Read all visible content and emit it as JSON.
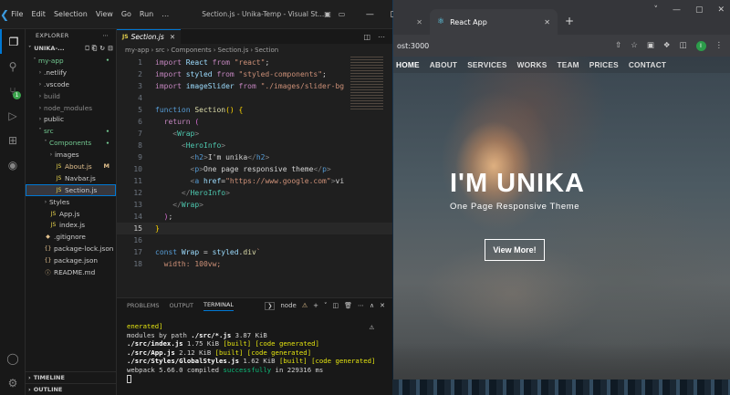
{
  "vscode": {
    "menu": [
      "File",
      "Edit",
      "Selection",
      "View",
      "Go",
      "Run",
      "…"
    ],
    "window_title": "Section.js - Unika-Temp - Visual St...",
    "explorer_title": "EXPLORER",
    "section_title": "UNIKA-...",
    "scm_badge": "1",
    "tree": [
      {
        "label": "my-app",
        "chev": "˅",
        "icon": "",
        "color": "c-green",
        "indent": 6,
        "status": "•",
        "status_color": "c-green"
      },
      {
        "label": ".netlify",
        "chev": "›",
        "icon": "",
        "color": "",
        "indent": 12,
        "status": "",
        "status_color": ""
      },
      {
        "label": ".vscode",
        "chev": "›",
        "icon": "",
        "color": "",
        "indent": 12,
        "status": "",
        "status_color": ""
      },
      {
        "label": "build",
        "chev": "›",
        "icon": "",
        "color": "c-gray",
        "indent": 12,
        "status": "",
        "status_color": ""
      },
      {
        "label": "node_modules",
        "chev": "›",
        "icon": "",
        "color": "c-gray",
        "indent": 12,
        "status": "",
        "status_color": ""
      },
      {
        "label": "public",
        "chev": "›",
        "icon": "",
        "color": "",
        "indent": 12,
        "status": "",
        "status_color": ""
      },
      {
        "label": "src",
        "chev": "˅",
        "icon": "",
        "color": "c-green",
        "indent": 12,
        "status": "•",
        "status_color": "c-green"
      },
      {
        "label": "Components",
        "chev": "˅",
        "icon": "",
        "color": "c-green",
        "indent": 18,
        "status": "•",
        "status_color": "c-green"
      },
      {
        "label": "images",
        "chev": "›",
        "icon": "",
        "color": "",
        "indent": 24,
        "status": "",
        "status_color": ""
      },
      {
        "label": "About.js",
        "chev": "",
        "icon": "JS",
        "color": "c-yellow",
        "indent": 24,
        "status": "M",
        "status_color": "c-yellow"
      },
      {
        "label": "Navbar.js",
        "chev": "",
        "icon": "JS",
        "color": "",
        "indent": 24,
        "status": "",
        "status_color": ""
      },
      {
        "label": "Section.js",
        "chev": "",
        "icon": "JS",
        "color": "",
        "indent": 24,
        "status": "",
        "status_color": "",
        "selected": true
      },
      {
        "label": "Styles",
        "chev": "›",
        "icon": "",
        "color": "",
        "indent": 18,
        "status": "",
        "status_color": ""
      },
      {
        "label": "App.js",
        "chev": "",
        "icon": "JS",
        "color": "",
        "indent": 18,
        "status": "",
        "status_color": ""
      },
      {
        "label": "index.js",
        "chev": "",
        "icon": "JS",
        "color": "",
        "indent": 18,
        "status": "",
        "status_color": ""
      },
      {
        "label": ".gitignore",
        "chev": "",
        "icon": "◆",
        "color": "",
        "indent": 12,
        "status": "",
        "status_color": ""
      },
      {
        "label": "package-lock.json",
        "chev": "",
        "icon": "{}",
        "color": "",
        "indent": 12,
        "status": "",
        "status_color": ""
      },
      {
        "label": "package.json",
        "chev": "",
        "icon": "{}",
        "color": "",
        "indent": 12,
        "status": "",
        "status_color": ""
      },
      {
        "label": "README.md",
        "chev": "",
        "icon": "ⓘ",
        "color": "",
        "indent": 12,
        "status": "",
        "status_color": ""
      }
    ],
    "footer": [
      "TIMELINE",
      "OUTLINE"
    ],
    "tab": "Section.js",
    "breadcrumb": [
      "my-app",
      "src",
      "Components",
      "Section.js",
      "Section"
    ],
    "current_line": 15,
    "code_lines": [
      [
        [
          "k",
          "import "
        ],
        [
          "v",
          "React "
        ],
        [
          "k",
          "from "
        ],
        [
          "s",
          "\"react\""
        ],
        [
          "tx",
          ";"
        ]
      ],
      [
        [
          "k",
          "import "
        ],
        [
          "v",
          "styled "
        ],
        [
          "k",
          "from "
        ],
        [
          "s",
          "\"styled-components\""
        ],
        [
          "tx",
          ";"
        ]
      ],
      [
        [
          "k",
          "import "
        ],
        [
          "v",
          "imageSlider "
        ],
        [
          "k",
          "from "
        ],
        [
          "s",
          "\"./images/slider-bg"
        ]
      ],
      [
        [
          "tx",
          ""
        ]
      ],
      [
        [
          "kb",
          "function "
        ],
        [
          "f",
          "Section"
        ],
        [
          "br",
          "() {"
        ]
      ],
      [
        [
          "tx",
          "  "
        ],
        [
          "k",
          "return "
        ],
        [
          "pu",
          "("
        ]
      ],
      [
        [
          "tx",
          "    "
        ],
        [
          "tb",
          "<"
        ],
        [
          "t",
          "Wrap"
        ],
        [
          "tb",
          ">"
        ]
      ],
      [
        [
          "tx",
          "      "
        ],
        [
          "tb",
          "<"
        ],
        [
          "t",
          "HeroInfo"
        ],
        [
          "tb",
          ">"
        ]
      ],
      [
        [
          "tx",
          "        "
        ],
        [
          "tb",
          "<"
        ],
        [
          "tg",
          "h2"
        ],
        [
          "tb",
          ">"
        ],
        [
          "tx",
          "I'm unika"
        ],
        [
          "tb",
          "</"
        ],
        [
          "tg",
          "h2"
        ],
        [
          "tb",
          ">"
        ]
      ],
      [
        [
          "tx",
          "        "
        ],
        [
          "tb",
          "<"
        ],
        [
          "tg",
          "p"
        ],
        [
          "tb",
          ">"
        ],
        [
          "tx",
          "One page responsive theme"
        ],
        [
          "tb",
          "</"
        ],
        [
          "tg",
          "p"
        ],
        [
          "tb",
          ">"
        ]
      ],
      [
        [
          "tx",
          "        "
        ],
        [
          "tb",
          "<"
        ],
        [
          "tg",
          "a "
        ],
        [
          "at",
          "href"
        ],
        [
          "tx",
          "="
        ],
        [
          "s",
          "\"https://www.google.com\""
        ],
        [
          "tb",
          ">"
        ],
        [
          "tx",
          "vi"
        ]
      ],
      [
        [
          "tx",
          "      "
        ],
        [
          "tb",
          "</"
        ],
        [
          "t",
          "HeroInfo"
        ],
        [
          "tb",
          ">"
        ]
      ],
      [
        [
          "tx",
          "    "
        ],
        [
          "tb",
          "</"
        ],
        [
          "t",
          "Wrap"
        ],
        [
          "tb",
          ">"
        ]
      ],
      [
        [
          "tx",
          "  "
        ],
        [
          "pu",
          ")"
        ],
        [
          "tx",
          ";"
        ]
      ],
      [
        [
          "br",
          "}"
        ]
      ],
      [
        [
          "tx",
          ""
        ]
      ],
      [
        [
          "kb",
          "const "
        ],
        [
          "v",
          "Wrap "
        ],
        [
          "tx",
          "= "
        ],
        [
          "v",
          "styled"
        ],
        [
          "tx",
          "."
        ],
        [
          "f",
          "div"
        ],
        [
          "s",
          "`"
        ]
      ],
      [
        [
          "s",
          "  width: 100vw;"
        ]
      ]
    ],
    "panel_tabs": [
      "PROBLEMS",
      "OUTPUT",
      "TERMINAL"
    ],
    "terminal_shell": "node",
    "terminal": [
      [
        [
          "ty",
          "enerated]"
        ]
      ],
      [
        [
          "tx",
          "  modules by path "
        ],
        [
          "tw",
          "./src/*.js"
        ],
        [
          "tx",
          " 3.87 KiB"
        ]
      ],
      [
        [
          "tx",
          "    "
        ],
        [
          "tw",
          "./src/index.js"
        ],
        [
          "tx",
          " 1.75 KiB "
        ],
        [
          "ty",
          "[built] [code generated]"
        ]
      ],
      [
        [
          "tx",
          "    "
        ],
        [
          "tw",
          "./src/App.js"
        ],
        [
          "tx",
          " 2.12 KiB "
        ],
        [
          "ty",
          "[built] [code generated]"
        ]
      ],
      [
        [
          "tx",
          "  "
        ],
        [
          "tw",
          "./src/Styles/GlobalStyles.js"
        ],
        [
          "tx",
          " 1.62 KiB "
        ],
        [
          "ty",
          "[built] [code generated]"
        ]
      ],
      [
        [
          "tx",
          "webpack 5.66.0 compiled "
        ],
        [
          "tgrn",
          "successfully"
        ],
        [
          "tx",
          " in 229316 ms"
        ]
      ]
    ]
  },
  "chrome": {
    "tab_title": "React App",
    "url": "ost:3000",
    "avatar": "I",
    "nav": [
      "HOME",
      "ABOUT",
      "SERVICES",
      "WORKS",
      "TEAM",
      "PRICES",
      "CONTACT"
    ],
    "hero_title": "I'M UNIKA",
    "hero_subtitle": "One Page Responsive Theme",
    "hero_button": "View More!"
  }
}
